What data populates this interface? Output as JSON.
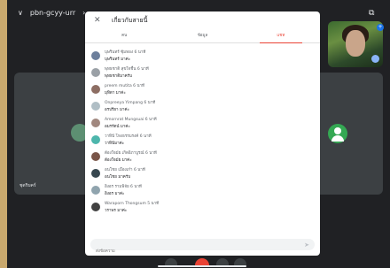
{
  "meeting": {
    "code": "pbn-gcyy-urr",
    "code_suffix": "›"
  },
  "tiles": {
    "left_name": "ชุดริบคร์"
  },
  "chat": {
    "title": "เกี่ยวกับสายนี้",
    "tabs": [
      {
        "label": "คน"
      },
      {
        "label": "ข้อมูล"
      },
      {
        "label": "แชท"
      }
    ],
    "input_placeholder": "ส่งข้อความ",
    "messages": [
      {
        "line1": "บุษรินทร์ ซุ้มทอง  6 นาที",
        "line2": "บุษรินทร์ มาค่ะ",
        "avatar_color": "#6d7f9c"
      },
      {
        "line1": "พุทธชาติ สุขใจชื่น  6 นาที",
        "line2": "พุทธชาติมาครับ",
        "avatar_color": "#9aa0a6"
      },
      {
        "line1": "preem mutita  6 นาที",
        "line2": "มุทิตา มาค่ะ",
        "avatar_color": "#8d6e63"
      },
      {
        "line1": "Onpreeya Yimpang  6 นาที",
        "line2": "อรปรียา มาค่ะ",
        "avatar_color": "#b0bec5"
      },
      {
        "line1": "Amornrat Mungsuai  6 นาที",
        "line2": "อมรรัตน์ มาค่ะ",
        "avatar_color": "#a1887f"
      },
      {
        "line1": "วาทินี โหงธรรมรงค์  6 นาที",
        "line2": "วาทินีมาค่ะ",
        "avatar_color": "#4db6ac"
      },
      {
        "line1": "ต้องใจมัย เกิดอิภาบูรณ์  6 นาที",
        "line2": "ต้องใจมัย มาค่ะ",
        "avatar_color": "#795548"
      },
      {
        "line1": "อนโชย เมืองเก๋า  6 นาที",
        "line2": "อนโชย มาครับ",
        "avatar_color": "#37474f"
      },
      {
        "line1": "อิงอร รามพิจัย  6 นาที",
        "line2": "อิงอร มาค่ะ",
        "avatar_color": "#90a4ae"
      },
      {
        "line1": "Waraporn Thongsum  5 นาที",
        "line2": "วราพร มาค่ะ",
        "avatar_color": "#424242"
      }
    ]
  },
  "colors": {
    "accent": "#ea4335",
    "blue": "#1a73e8",
    "bg": "#202124"
  }
}
